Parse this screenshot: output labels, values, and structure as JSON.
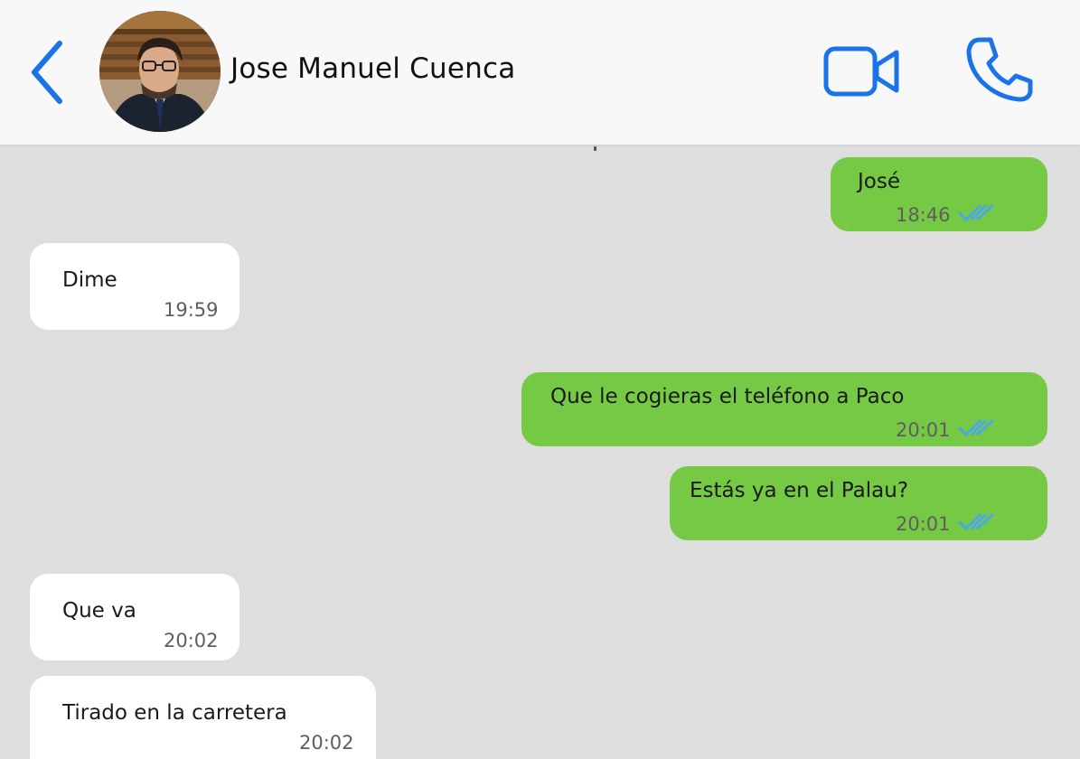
{
  "header": {
    "contact_name": "Jose Manuel Cuenca",
    "back_icon": "chevron-left-icon",
    "video_icon": "video-camera-icon",
    "call_icon": "phone-icon",
    "accent_color": "#1a73e8"
  },
  "messages": [
    {
      "direction": "out",
      "text": "José",
      "time": "18:46",
      "read": true
    },
    {
      "direction": "in",
      "text": "Dime",
      "time": "19:59"
    },
    {
      "direction": "out",
      "text": "Que le cogieras el teléfono a Paco",
      "time": "20:01",
      "read": true
    },
    {
      "direction": "out",
      "text": "Estás ya en el Palau?",
      "time": "20:01",
      "read": true
    },
    {
      "direction": "in",
      "text": "Que va",
      "time": "20:02"
    },
    {
      "direction": "in",
      "text": "Tirado en la carretera",
      "time": "20:02"
    }
  ],
  "colors": {
    "outgoing_bubble": "#76c944",
    "incoming_bubble": "#ffffff",
    "chat_background": "#dedede",
    "read_ticks": "#4aa8e8"
  }
}
